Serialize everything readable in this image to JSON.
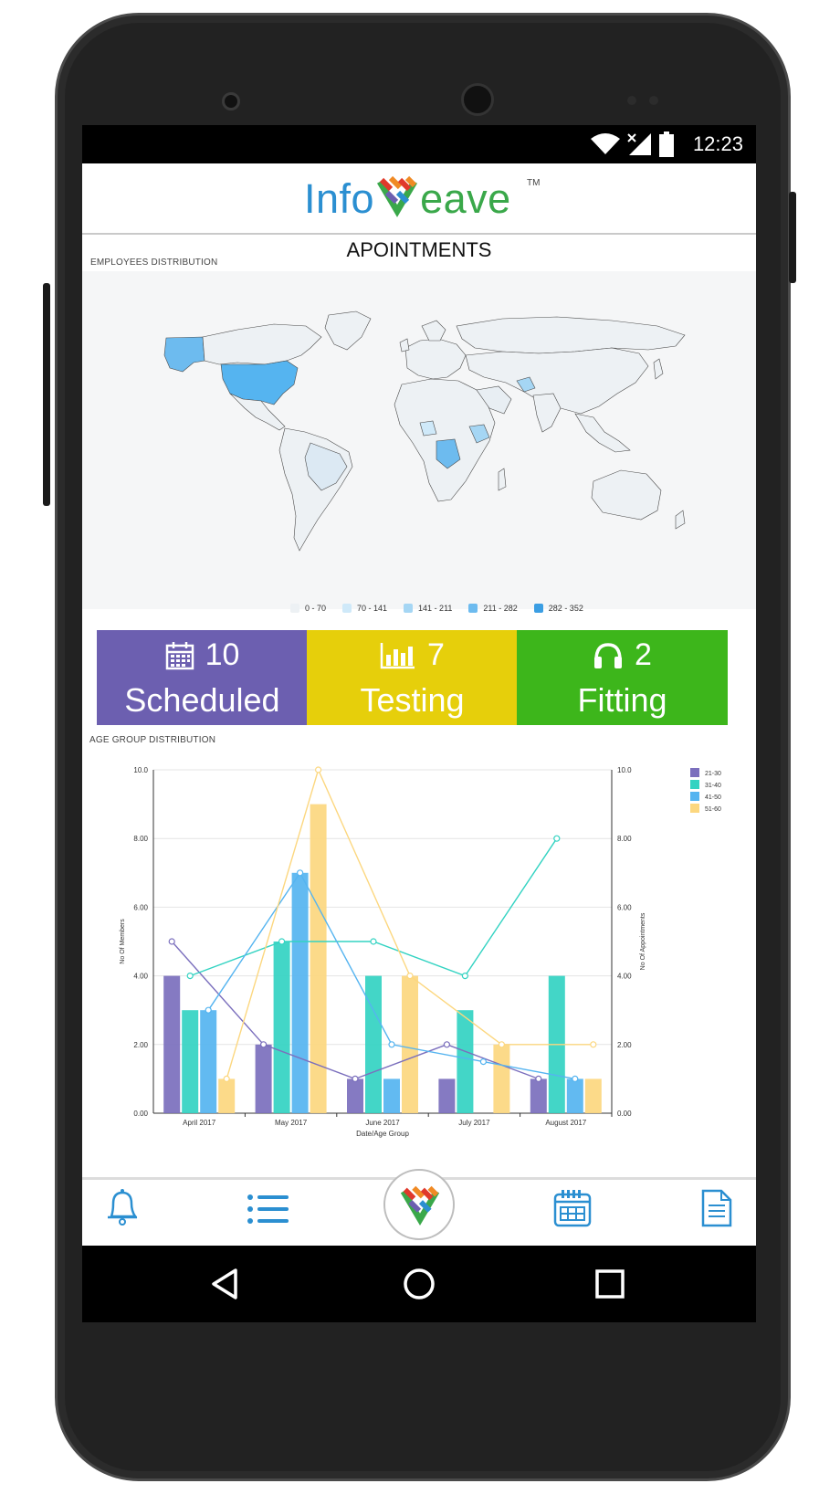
{
  "status": {
    "time": "12:23"
  },
  "brand": {
    "logo_left": "Info",
    "logo_right": "eave",
    "tm": "TM"
  },
  "page": {
    "title": "APOINTMENTS"
  },
  "map": {
    "label": "EMPLOYEES DISTRIBUTION",
    "legend": [
      {
        "label": "0 - 70",
        "color": "#edf1f4"
      },
      {
        "label": "70 - 141",
        "color": "#cfe9f9"
      },
      {
        "label": "141 - 211",
        "color": "#a5d6f4"
      },
      {
        "label": "211 - 282",
        "color": "#6dbbef"
      },
      {
        "label": "282 - 352",
        "color": "#3b9ee3"
      }
    ]
  },
  "tiles": [
    {
      "count": "10",
      "label": "Scheduled",
      "color": "#6c5fb0",
      "icon": "calendar-icon"
    },
    {
      "count": "7",
      "label": "Testing",
      "color": "#e6cf0b",
      "icon": "bar-chart-icon"
    },
    {
      "count": "2",
      "label": "Fitting",
      "color": "#3db61b",
      "icon": "headphones-icon"
    }
  ],
  "age_chart": {
    "label": "AGE GROUP DISTRIBUTION"
  },
  "chart_data": {
    "type": "bar",
    "title": "AGE GROUP DISTRIBUTION",
    "xlabel": "Date/Age Group",
    "ylabel": "No Of Members",
    "y2label": "No Of Appointments",
    "ylim": [
      0,
      10
    ],
    "y2lim": [
      0,
      10
    ],
    "yticks": [
      "0.00",
      "2.00",
      "4.00",
      "6.00",
      "8.00",
      "10.0"
    ],
    "categories": [
      "April 2017",
      "May 2017",
      "June 2017",
      "July 2017",
      "August 2017"
    ],
    "legend_position": "top-right",
    "grid": true,
    "series": [
      {
        "name": "21-30",
        "color": "#7b6fbd",
        "bar_values": [
          4,
          2,
          1,
          1,
          1
        ],
        "line_values": [
          5,
          2,
          1,
          2,
          1
        ]
      },
      {
        "name": "31-40",
        "color": "#33d3c2",
        "bar_values": [
          3,
          5,
          4,
          3,
          4
        ],
        "line_values": [
          4,
          5,
          5,
          4,
          8
        ]
      },
      {
        "name": "41-50",
        "color": "#55b4f0",
        "bar_values": [
          3,
          7,
          1,
          0,
          1
        ],
        "line_values": [
          3,
          7,
          2,
          1.5,
          1
        ]
      },
      {
        "name": "51-60",
        "color": "#fcd77f",
        "bar_values": [
          1,
          9,
          4,
          2,
          1
        ],
        "line_values": [
          1,
          10,
          4,
          2,
          2
        ]
      }
    ]
  }
}
